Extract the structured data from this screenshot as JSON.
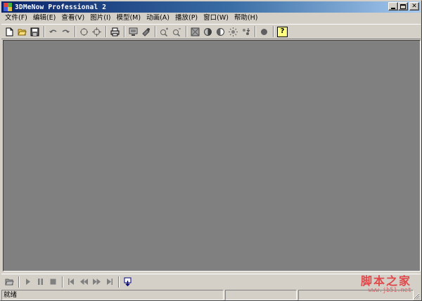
{
  "window": {
    "title": "3DMeNow Professional 2"
  },
  "menu": {
    "items": [
      {
        "id": "file",
        "label": "文件(F)"
      },
      {
        "id": "edit",
        "label": "编辑(E)"
      },
      {
        "id": "view",
        "label": "查看(V)"
      },
      {
        "id": "picture",
        "label": "图片(I)"
      },
      {
        "id": "model",
        "label": "模型(M)"
      },
      {
        "id": "animation",
        "label": "动画(A)"
      },
      {
        "id": "play",
        "label": "播放(P)"
      },
      {
        "id": "window",
        "label": "窗口(W)"
      },
      {
        "id": "help",
        "label": "帮助(H)"
      }
    ]
  },
  "toolbar": {
    "help_label": "?"
  },
  "icons": {
    "toolbar": [
      "new-file-icon",
      "open-folder-icon",
      "save-icon",
      "undo-icon",
      "redo-icon",
      "rotate-icon",
      "crosshair-icon",
      "print-icon",
      "monitor-icon",
      "camera-icon",
      "zoom-in-icon",
      "zoom-out-icon",
      "texture-icon",
      "shading-icon",
      "half-circle-icon",
      "light-icon",
      "morph-icon",
      "record-icon",
      "help-icon"
    ],
    "playback": [
      "open-folder-icon",
      "play-icon",
      "pause-icon",
      "stop-icon",
      "first-frame-icon",
      "rewind-icon",
      "fast-forward-icon",
      "last-frame-icon",
      "export-icon"
    ]
  },
  "watermark": {
    "text": "脚本之家",
    "url": "www.jb51.net"
  },
  "status": {
    "text": "就绪"
  },
  "colors": {
    "title_start": "#0a246a",
    "title_end": "#a6caf0",
    "viewport": "#808080",
    "chrome": "#d4d0c8",
    "watermark": "#e0484a"
  }
}
